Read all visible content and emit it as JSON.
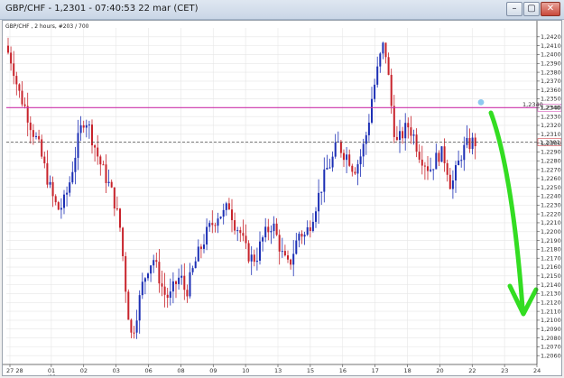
{
  "window": {
    "title": "GBP/CHF - 1,2301 - 07:40:53  22 mar (CET)",
    "minimize": "–",
    "maximize": "▢",
    "close": "✕"
  },
  "chart": {
    "symbol_label": "GBP/CHF , 2 hours, #203 / 700",
    "current_price_label": "1,2301",
    "resistance_label": "1,2340",
    "colors": {
      "up": "#1c2fb5",
      "down": "#c8232b",
      "resistance": "#cc33aa",
      "arrow": "#33dd22",
      "marker": "#8ec9f0"
    }
  },
  "chart_data": {
    "type": "candlestick",
    "y_range": [
      1.205,
      1.243
    ],
    "y_ticks": [
      "1,2420",
      "1,2410",
      "1,2400",
      "1,2390",
      "1,2380",
      "1,2370",
      "1,2360",
      "1,2350",
      "1,2340",
      "1,2330",
      "1,2320",
      "1,2310",
      "1,2300",
      "1,2290",
      "1,2280",
      "1,2270",
      "1,2260",
      "1,2250",
      "1,2240",
      "1,2230",
      "1,2220",
      "1,2210",
      "1,2200",
      "1,2190",
      "1,2180",
      "1,2170",
      "1,2160",
      "1,2150",
      "1,2140",
      "1,2130",
      "1,2120",
      "1,2110",
      "1,2100",
      "1,2090",
      "1,2080",
      "1,2070",
      "1,2060"
    ],
    "x_ticks": [
      "27 28",
      "01",
      "02",
      "03",
      "06",
      "08",
      "09",
      "10",
      "13",
      "15",
      "16",
      "17",
      "18",
      "20",
      "22",
      "23",
      "24"
    ],
    "x_sub_label": "mar/01",
    "resistance": 1.234,
    "current": 1.2301,
    "path": [
      [
        0,
        1.241
      ],
      [
        8,
        1.239
      ],
      [
        14,
        1.236
      ],
      [
        22,
        1.234
      ],
      [
        30,
        1.2315
      ],
      [
        36,
        1.23
      ],
      [
        44,
        1.227
      ],
      [
        52,
        1.224
      ],
      [
        58,
        1.2225
      ],
      [
        64,
        1.223
      ],
      [
        70,
        1.225
      ],
      [
        76,
        1.228
      ],
      [
        82,
        1.231
      ],
      [
        88,
        1.233
      ],
      [
        92,
        1.232
      ],
      [
        98,
        1.23
      ],
      [
        104,
        1.228
      ],
      [
        110,
        1.2265
      ],
      [
        116,
        1.225
      ],
      [
        122,
        1.223
      ],
      [
        128,
        1.22
      ],
      [
        132,
        1.215
      ],
      [
        136,
        1.211
      ],
      [
        140,
        1.208
      ],
      [
        146,
        1.211
      ],
      [
        152,
        1.214
      ],
      [
        158,
        1.216
      ],
      [
        164,
        1.217
      ],
      [
        170,
        1.215
      ],
      [
        176,
        1.213
      ],
      [
        182,
        1.2125
      ],
      [
        188,
        1.214
      ],
      [
        194,
        1.215
      ],
      [
        200,
        1.213
      ],
      [
        206,
        1.215
      ],
      [
        212,
        1.217
      ],
      [
        218,
        1.2185
      ],
      [
        224,
        1.22
      ],
      [
        230,
        1.221
      ],
      [
        236,
        1.222
      ],
      [
        242,
        1.222
      ],
      [
        248,
        1.223
      ],
      [
        254,
        1.221
      ],
      [
        260,
        1.22
      ],
      [
        266,
        1.218
      ],
      [
        272,
        1.217
      ],
      [
        278,
        1.217
      ],
      [
        284,
        1.219
      ],
      [
        290,
        1.22
      ],
      [
        296,
        1.221
      ],
      [
        302,
        1.219
      ],
      [
        308,
        1.217
      ],
      [
        314,
        1.216
      ],
      [
        320,
        1.218
      ],
      [
        326,
        1.22
      ],
      [
        332,
        1.2195
      ],
      [
        338,
        1.221
      ],
      [
        344,
        1.223
      ],
      [
        350,
        1.225
      ],
      [
        356,
        1.227
      ],
      [
        362,
        1.228
      ],
      [
        368,
        1.23
      ],
      [
        374,
        1.229
      ],
      [
        380,
        1.2285
      ],
      [
        386,
        1.227
      ],
      [
        392,
        1.228
      ],
      [
        398,
        1.23
      ],
      [
        402,
        1.232
      ],
      [
        406,
        1.235
      ],
      [
        410,
        1.237
      ],
      [
        414,
        1.239
      ],
      [
        418,
        1.241
      ],
      [
        422,
        1.24
      ],
      [
        426,
        1.236
      ],
      [
        430,
        1.232
      ],
      [
        434,
        1.23
      ],
      [
        440,
        1.231
      ],
      [
        446,
        1.232
      ],
      [
        452,
        1.231
      ],
      [
        458,
        1.229
      ],
      [
        464,
        1.228
      ],
      [
        470,
        1.227
      ],
      [
        476,
        1.228
      ],
      [
        482,
        1.229
      ],
      [
        488,
        1.228
      ],
      [
        494,
        1.225
      ],
      [
        500,
        1.227
      ],
      [
        506,
        1.229
      ],
      [
        512,
        1.2298
      ],
      [
        518,
        1.2301
      ]
    ]
  }
}
